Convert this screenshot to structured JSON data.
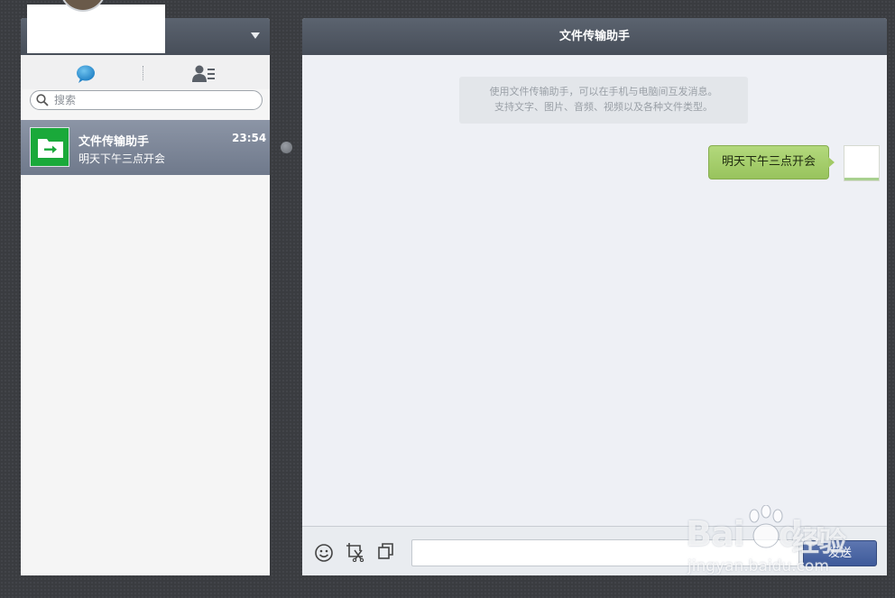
{
  "sidebar": {
    "search": {
      "placeholder": "搜索"
    },
    "conversations": [
      {
        "name": "文件传输助手",
        "time": "23:54",
        "preview": "明天下午三点开会",
        "icon": "file-transfer-icon"
      }
    ]
  },
  "chat": {
    "title": "文件传输助手",
    "notice": {
      "line1": "使用文件传输助手，可以在手机与电脑间互发消息。",
      "line2": "支持文字、图片、音频、视频以及各种文件类型。"
    },
    "messages": [
      {
        "text": "明天下午三点开会",
        "sender": "me"
      }
    ],
    "toolbar": {
      "icons": [
        "emoji-icon",
        "screenshot-icon",
        "copy-icon"
      ]
    },
    "send_label": "发送"
  },
  "watermark": {
    "logo": "Bai",
    "logo2": "du",
    "text": "经验",
    "url": "jingyan.baidu.com"
  },
  "colors": {
    "header": "#4f5763",
    "selected_item": "#7d8799",
    "bubble": "#a6cf6c",
    "send_button": "#4a64a3",
    "avatar_green": "#1aa93a"
  }
}
